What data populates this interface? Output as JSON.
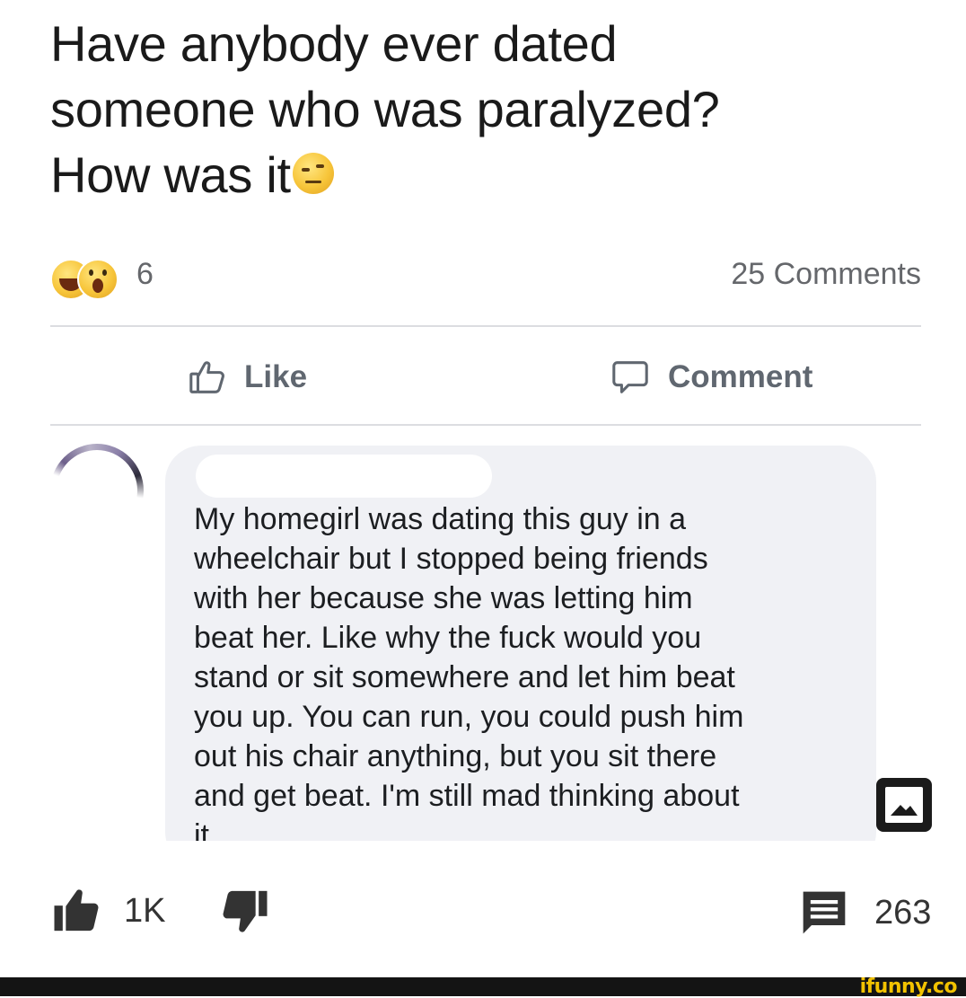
{
  "post": {
    "text_lines": [
      "Have anybody ever dated",
      "someone who was paralyzed?",
      "How was it"
    ],
    "text_emoji": "raised-eyebrow-emoji",
    "reaction_icons": [
      "haha-reaction-icon",
      "wow-reaction-icon"
    ],
    "reaction_count": "6",
    "comments_count": "25 Comments"
  },
  "actions": {
    "like_label": "Like",
    "comment_label": "Comment"
  },
  "comment": {
    "author_redacted": true,
    "text_lines": [
      "My homegirl was dating this guy in a",
      "wheelchair but I stopped being friends",
      "with her because she was letting him",
      "beat her. Like why the fuck would you",
      "stand or sit somewhere and let him beat",
      "you up. You can run, you could push him",
      "out his chair anything, but you sit there",
      "and get beat. I'm still mad thinking about",
      "it"
    ]
  },
  "footer": {
    "like_count": "1K",
    "comment_count": "263",
    "watermark": "ifunny.co"
  },
  "colors": {
    "secondary_text": "#65676b",
    "action_text": "#606770",
    "bubble_bg": "#f0f1f5",
    "watermark": "#f2c200"
  }
}
